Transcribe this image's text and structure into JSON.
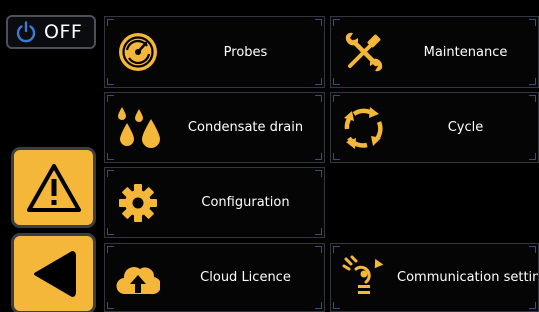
{
  "power_button": {
    "label": "OFF",
    "icon": "power-icon"
  },
  "side_buttons": [
    {
      "id": "warning",
      "icon": "warning-triangle-icon"
    },
    {
      "id": "back",
      "icon": "back-arrow-icon"
    }
  ],
  "menu": {
    "probes": {
      "label": "Probes",
      "icon": "probe-gauge-icon"
    },
    "maintenance": {
      "label": "Maintenance",
      "icon": "wrench-screwdriver-icon"
    },
    "condensate_drain": {
      "label": "Condensate drain",
      "icon": "droplets-icon"
    },
    "cycle": {
      "label": "Cycle",
      "icon": "cycle-arrows-icon"
    },
    "configuration": {
      "label": "Configuration",
      "icon": "gear-icon"
    },
    "cloud_licence": {
      "label": "Cloud Licence",
      "icon": "cloud-upload-icon"
    },
    "communication_settings": {
      "label": "Communication settings",
      "icon": "signal-antenna-icon"
    }
  },
  "colors": {
    "accent": "#f5b739",
    "background": "#000000",
    "tile_border": "#33363c",
    "text": "#ffffff"
  }
}
